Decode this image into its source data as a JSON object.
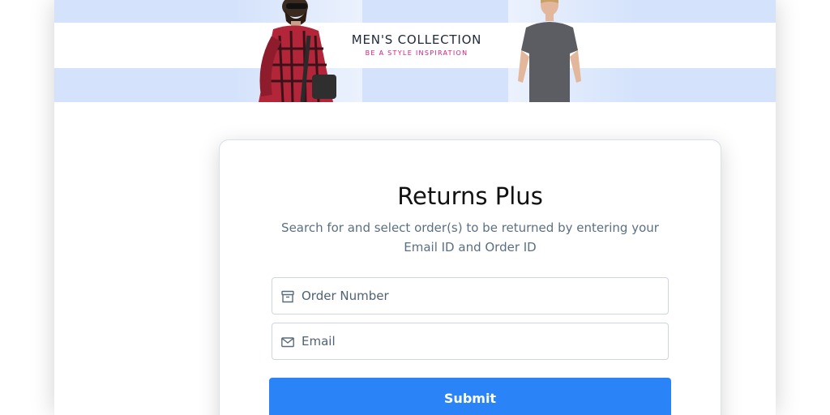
{
  "banner": {
    "title": "MEN'S COLLECTION",
    "subtitle": "BE A STYLE INSPIRATION"
  },
  "form": {
    "title": "Returns Plus",
    "description": "Search for and select order(s) to be returned by entering your Email ID and Order ID",
    "order_field": {
      "icon": "archive-box-icon",
      "placeholder": "Order Number",
      "value": ""
    },
    "email_field": {
      "icon": "envelope-icon",
      "placeholder": "Email",
      "value": ""
    },
    "submit_label": "Submit"
  },
  "colors": {
    "banner_bg": "#d4e2fb",
    "accent": "#2a83f7",
    "subtitle_pink": "#d81b7a",
    "description_text": "#5a7082"
  }
}
